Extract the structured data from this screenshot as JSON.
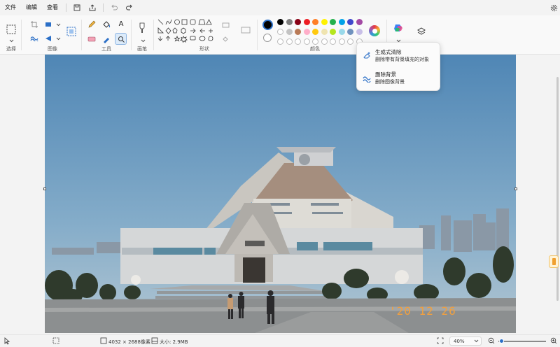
{
  "menu": {
    "file": "文件",
    "edit": "编辑",
    "view": "查看"
  },
  "groups": {
    "select": "选择",
    "image": "图像",
    "tools": "工具",
    "brushes": "画笔",
    "shapes": "形状",
    "colors": "颜色"
  },
  "popup": {
    "item1_title": "生成式清除",
    "item1_desc": "删除带有背景填充的对象",
    "item2_title": "删除背景",
    "item2_desc": "删除图像背景"
  },
  "status": {
    "dimensions": "4032 × 2688像素",
    "size": "大小: 2.9MB",
    "zoom": "40%",
    "zoom_level": 0.4
  },
  "photo": {
    "timestamp": "'20 12 26"
  },
  "palette": {
    "current_primary": "#000000",
    "current_secondary": "#ffffff",
    "row1": [
      "#000000",
      "#7f7f7f",
      "#880015",
      "#ed1c24",
      "#ff7f27",
      "#fff200",
      "#22b14c",
      "#00a2e8",
      "#3f48cc",
      "#a349a4"
    ],
    "row2": [
      "#ffffff",
      "#c3c3c3",
      "#b97a57",
      "#ffaec9",
      "#ffc90e",
      "#efe4b0",
      "#b5e61d",
      "#99d9ea",
      "#7092be",
      "#c8bfe7"
    ],
    "row3": [
      "#ffffff",
      "#ffffff",
      "#ffffff",
      "#ffffff",
      "#ffffff",
      "#ffffff",
      "#ffffff",
      "#ffffff",
      "#ffffff",
      "#ffffff"
    ]
  }
}
